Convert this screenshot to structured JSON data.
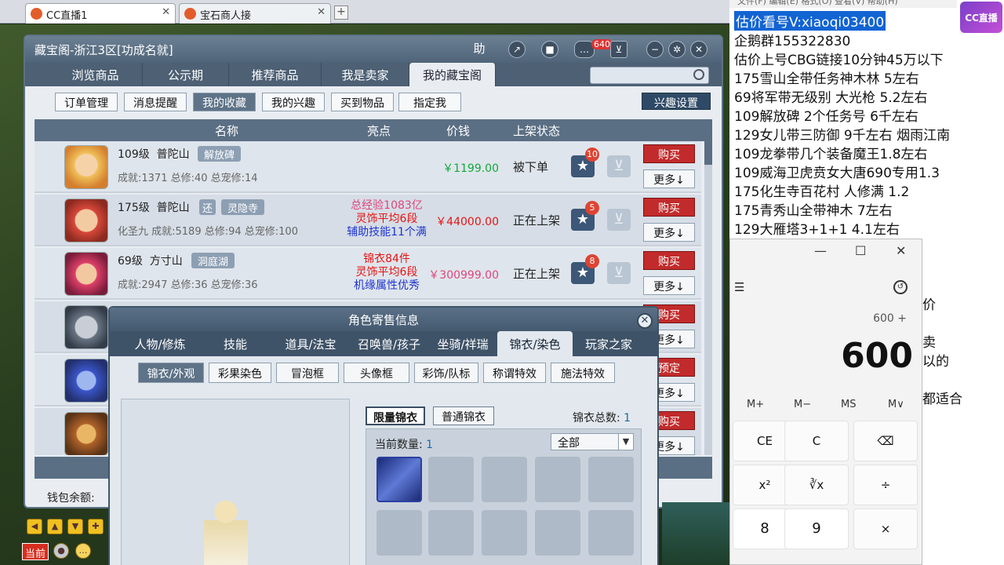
{
  "browser": {
    "tabs": [
      {
        "label": "CC直播1",
        "active": true
      },
      {
        "label": "宝石商人接",
        "active": false
      }
    ],
    "close_glyph": "✕",
    "new_tab_glyph": "+"
  },
  "main": {
    "title": "藏宝阁-浙江3区[功成名就]",
    "help_label": "助",
    "notify_count": "640",
    "tabs": [
      "浏览商品",
      "公示期",
      "推荐商品",
      "我是卖家",
      "我的藏宝阁"
    ],
    "active_tab": 4,
    "subnav": [
      "订单管理",
      "消息提醒",
      "我的收藏",
      "我的兴趣",
      "买到物品",
      "指定我"
    ],
    "active_subnav": 2,
    "interest_button": "兴趣设置",
    "columns": [
      "名称",
      "亮点",
      "价钱",
      "上架状态"
    ],
    "rows": [
      {
        "level": "109级",
        "school": "普陀山",
        "tags": [
          "解放碑"
        ],
        "stats": "成就:1371  总修:40  总宠修:14",
        "highlights": [],
        "price": "￥1199.00",
        "price_color": "#11a83c",
        "status": "被下单",
        "fav_count": "10",
        "buy": "购买",
        "more": "更多↓"
      },
      {
        "level": "175级",
        "school": "普陀山",
        "tags": [
          "还",
          "灵隐寺"
        ],
        "stats": "化圣九  成就:5189  总修:94  总宠修:100",
        "highlights": [
          {
            "text": "总经验1083亿",
            "color": "#e0457b"
          },
          {
            "text": "灵饰平均6段",
            "color": "#e61414"
          },
          {
            "text": "辅助技能11个满",
            "color": "#1f34d1"
          }
        ],
        "price": "￥44000.00",
        "price_color": "#e61414",
        "status": "正在上架",
        "fav_count": "5",
        "buy": "购买",
        "more": "更多↓"
      },
      {
        "level": "69级",
        "school": "方寸山",
        "tags": [
          "洞庭湖"
        ],
        "stats": "成就:2947  总修:36  总宠修:36",
        "highlights": [
          {
            "text": "锦衣84件",
            "color": "#e61414"
          },
          {
            "text": "灵饰平均6段",
            "color": "#e61414"
          },
          {
            "text": "机缘属性优秀",
            "color": "#1f34d1"
          }
        ],
        "price": "￥300999.00",
        "price_color": "#e0457b",
        "status": "正在上架",
        "fav_count": "8",
        "buy": "购买",
        "more": "更多↓"
      },
      {
        "buy": "购买",
        "more": "更多↓"
      },
      {
        "buy": "预定",
        "more": "更多↓"
      },
      {
        "buy": "购买",
        "more": "更多↓"
      }
    ],
    "wallet_label": "钱包余额:"
  },
  "popup": {
    "title": "角色寄售信息",
    "tabs": [
      "人物/修炼",
      "技能",
      "道具/法宝",
      "召唤兽/孩子",
      "坐骑/祥瑞",
      "锦衣/染色",
      "玩家之家"
    ],
    "active_tab": 5,
    "subtabs": [
      "锦衣/外观",
      "彩果染色",
      "冒泡框",
      "头像框",
      "彩饰/队标",
      "称谓特效",
      "施法特效"
    ],
    "active_subtab": 0,
    "outfit_types": [
      "限量锦衣",
      "普通锦衣"
    ],
    "outfit_total_label": "锦衣总数:",
    "outfit_total": "1",
    "current_count_label": "当前数量:",
    "current_count": "1",
    "filter_value": "全部"
  },
  "game_toolbar": {
    "current_channel": "当前"
  },
  "overlay": {
    "menu_text": "文件(F)  编辑(E)  格式(O)  查看(V)  帮助(H)",
    "logo_text": "CC直播",
    "lines": [
      "估价看号V:xiaoqi03400",
      "企鹅群155322830",
      "估价上号CBG链接10分钟45万以下",
      "175雪山全带任务神木林 5左右",
      "69将军带无级别 大光枪 5.2左右",
      "109解放碑 2个任务号 6千左右",
      "129女儿带三防御 9千左右 烟雨江南",
      "109龙拳带几个装备魔王1.8左右",
      "109威海卫虎贲女大唐690专用1.3",
      "175化生寺百花村 人修满 1.2",
      "175青秀山全带神木  7左右",
      "129大雁塔3+1+1  4.1左右"
    ],
    "partial_lines": [
      "价",
      "卖",
      "以的",
      "都适合"
    ]
  },
  "calculator": {
    "window_buttons": [
      "—",
      "☐",
      "✕"
    ],
    "menu_glyph": "☰",
    "expression": "600 +",
    "display": "600",
    "memory": [
      "M+",
      "M−",
      "MS",
      "M∨"
    ],
    "keys": [
      "CE",
      "C",
      "⌫",
      "x²",
      "∛x",
      "÷",
      "8",
      "9",
      "×"
    ]
  }
}
